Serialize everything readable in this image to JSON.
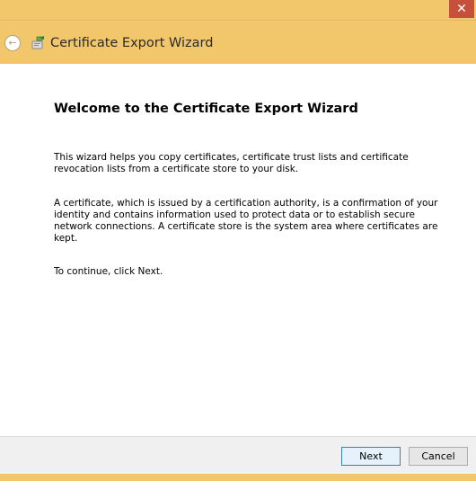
{
  "window": {
    "title": "Certificate Export Wizard",
    "close_label": "✕",
    "accent_color": "#f2c76b"
  },
  "nav": {
    "back_icon": "back-arrow-icon",
    "back_glyph": "←"
  },
  "content": {
    "heading": "Welcome to the Certificate Export Wizard",
    "paragraph1": "This wizard helps you copy certificates, certificate trust lists and certificate revocation lists from a certificate store to your disk.",
    "paragraph2": "A certificate, which is issued by a certification authority, is a confirmation of your identity and contains information used to protect data or to establish secure network connections. A certificate store is the system area where certificates are kept.",
    "paragraph3": "To continue, click Next."
  },
  "footer": {
    "next_label": "Next",
    "cancel_label": "Cancel"
  }
}
